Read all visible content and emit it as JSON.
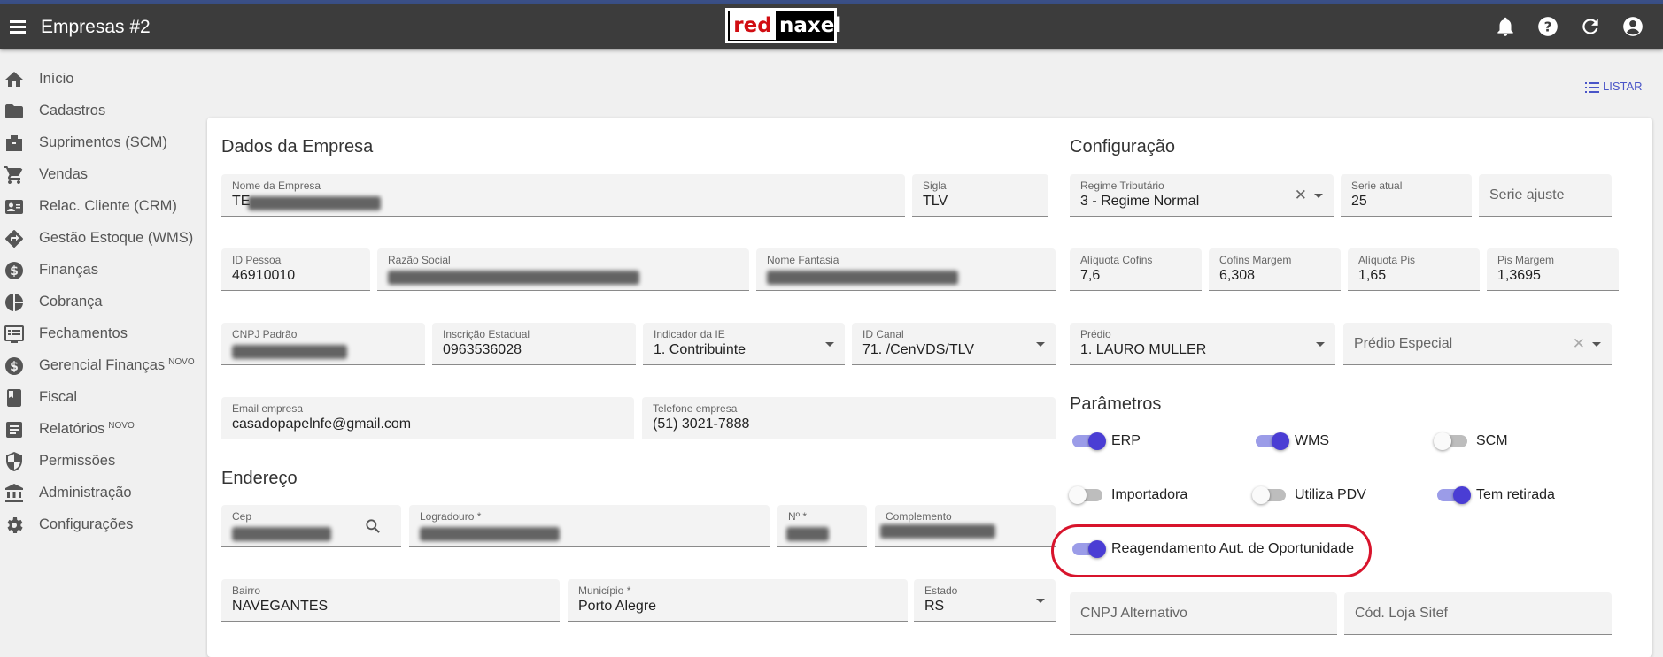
{
  "header": {
    "title": "Empresas #2",
    "logo_left": "red",
    "logo_right": "naxel"
  },
  "icons": {
    "menu": "menu-icon",
    "bell": "bell-icon",
    "help": "help-icon",
    "refresh": "refresh-icon",
    "account": "account-icon"
  },
  "sidebar": {
    "items": [
      {
        "label": "Início",
        "badge": ""
      },
      {
        "label": "Cadastros",
        "badge": ""
      },
      {
        "label": "Suprimentos (SCM)",
        "badge": ""
      },
      {
        "label": "Vendas",
        "badge": ""
      },
      {
        "label": "Relac. Cliente (CRM)",
        "badge": ""
      },
      {
        "label": "Gestão Estoque (WMS)",
        "badge": ""
      },
      {
        "label": "Finanças",
        "badge": ""
      },
      {
        "label": "Cobrança",
        "badge": ""
      },
      {
        "label": "Fechamentos",
        "badge": ""
      },
      {
        "label": "Gerencial Finanças",
        "badge": "NOVO"
      },
      {
        "label": "Fiscal",
        "badge": ""
      },
      {
        "label": "Relatórios",
        "badge": "NOVO"
      },
      {
        "label": "Permissões",
        "badge": ""
      },
      {
        "label": "Administração",
        "badge": ""
      },
      {
        "label": "Configurações",
        "badge": ""
      }
    ]
  },
  "toolbar": {
    "listar": "LISTAR"
  },
  "dados": {
    "title": "Dados da Empresa",
    "nome_empresa": {
      "label": "Nome da Empresa",
      "value": "TE"
    },
    "sigla": {
      "label": "Sigla",
      "value": "TLV"
    },
    "id_pessoa": {
      "label": "ID Pessoa",
      "value": "46910010"
    },
    "razao_social": {
      "label": "Razão Social",
      "value": ""
    },
    "nome_fantasia": {
      "label": "Nome Fantasia",
      "value": ""
    },
    "cnpj": {
      "label": "CNPJ Padrão",
      "value": ""
    },
    "inscricao": {
      "label": "Inscrição Estadual",
      "value": "0963536028"
    },
    "indicador_ie": {
      "label": "Indicador da IE",
      "value": "1. Contribuinte"
    },
    "id_canal": {
      "label": "ID Canal",
      "value": "71. /CenVDS/TLV"
    },
    "email": {
      "label": "Email empresa",
      "value": "casadopapelnfe@gmail.com"
    },
    "telefone": {
      "label": "Telefone empresa",
      "value": "(51) 3021-7888"
    }
  },
  "endereco": {
    "title": "Endereço",
    "cep": {
      "label": "Cep",
      "value": ""
    },
    "logradouro": {
      "label": "Logradouro *",
      "value": ""
    },
    "numero": {
      "label": "Nº *",
      "value": ""
    },
    "complemento": {
      "label": "Complemento",
      "value": ""
    },
    "bairro": {
      "label": "Bairro",
      "value": "NAVEGANTES"
    },
    "municipio": {
      "label": "Município *",
      "value": "Porto Alegre"
    },
    "estado": {
      "label": "Estado",
      "value": "RS"
    }
  },
  "config": {
    "title": "Configuração",
    "regime": {
      "label": "Regime Tributário",
      "value": "3 - Regime Normal"
    },
    "serie_atual": {
      "label": "Serie atual",
      "value": "25"
    },
    "serie_ajuste": {
      "placeholder": "Serie ajuste"
    },
    "aliq_cofins": {
      "label": "Alíquota Cofins",
      "value": "7,6"
    },
    "cofins_margem": {
      "label": "Cofins Margem",
      "value": "6,308"
    },
    "aliq_pis": {
      "label": "Alíquota Pis",
      "value": "1,65"
    },
    "pis_margem": {
      "label": "Pis Margem",
      "value": "1,3695"
    },
    "predio": {
      "label": "Prédio",
      "value": "1. LAURO MULLER"
    },
    "predio_especial": {
      "placeholder": "Prédio Especial"
    }
  },
  "parametros": {
    "title": "Parâmetros",
    "toggles": [
      {
        "label": "ERP",
        "on": true
      },
      {
        "label": "WMS",
        "on": true
      },
      {
        "label": "SCM",
        "on": false
      },
      {
        "label": "Importadora",
        "on": false
      },
      {
        "label": "Utiliza PDV",
        "on": false
      },
      {
        "label": "Tem retirada",
        "on": true
      },
      {
        "label": "Reagendamento Aut. de Oportunidade",
        "on": true
      }
    ],
    "cnpj_alternativo": {
      "placeholder": "CNPJ Alternativo"
    },
    "cod_loja_sitef": {
      "placeholder": "Cód. Loja Sitef"
    }
  },
  "colors": {
    "accent": "#4a3dd4",
    "appbar": "#3c3c3c",
    "highlight": "#d8142c",
    "link": "#4a55c8"
  }
}
